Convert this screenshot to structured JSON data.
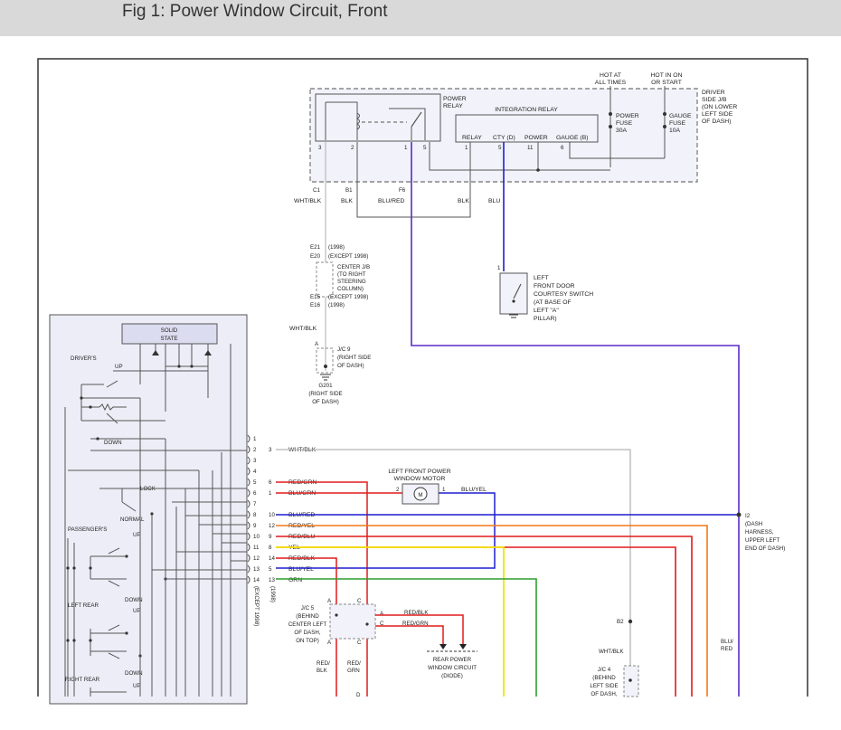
{
  "header": {
    "title": "Fig 1: Power Window Circuit, Front"
  },
  "colors": {
    "header_bg": "#d9d9d9",
    "blue": "#1f1fd1",
    "purple": "#5a2bc8",
    "red": "#e01b1b",
    "orange": "#f07818",
    "yellow": "#f2e600",
    "green": "#2e9e2e",
    "gray": "#b5b5b5",
    "dark": "#555555",
    "panel_bg": "#ededf7"
  },
  "junction_block": {
    "top_labels": [
      {
        "text": "HOT AT",
        "line2": "ALL TIMES"
      },
      {
        "text": "HOT IN ON",
        "line2": "OR START"
      }
    ],
    "name_lines": [
      "DRIVER",
      "SIDE J/B",
      "(ON LOWER",
      "LEFT SIDE",
      "OF DASH)"
    ],
    "power_relay": [
      "POWER",
      "RELAY"
    ],
    "integration_relay": "INTEGRATION RELAY",
    "relay_pins": [
      "RELAY",
      "CTY (D)",
      "POWER",
      "GAUGE (B)"
    ],
    "relay_pin_numbers": [
      "1",
      "5",
      "11",
      "6"
    ],
    "power_fuse": [
      "POWER",
      "FUSE",
      "30A"
    ],
    "gauge_fuse": [
      "GAUGE",
      "FUSE",
      "10A"
    ],
    "relay_coil_pins": [
      "3",
      "2",
      "1",
      "5"
    ],
    "connectors": [
      "C1",
      "B1",
      "F6"
    ]
  },
  "wires_top": [
    "WHT/BLK",
    "BLK",
    "BLU/RED",
    "BLK",
    "BLU"
  ],
  "center_jb": {
    "labels": [
      "E21",
      "(1998)",
      "E20",
      "(EXCEPT 1998)",
      "E15",
      "(EXCEPT 1998)",
      "E16",
      "(1998)"
    ],
    "name": [
      "CENTER J/B",
      "(TO RIGHT",
      "STEERING",
      "COLUMN)"
    ]
  },
  "courtesy_switch": {
    "pin": "1",
    "name": [
      "LEFT",
      "FRONT DOOR",
      "COURTESY SWITCH",
      "(AT BASE OF",
      "LEFT \"A\"",
      "PILLAR)"
    ]
  },
  "jc9": {
    "wire": "WHT/BLK",
    "pin": "A",
    "name": [
      "J/C 9",
      "(RIGHT SIDE",
      "OF DASH)"
    ],
    "ground": [
      "G201",
      "(RIGHT SIDE",
      "OF DASH)"
    ]
  },
  "master_switch": {
    "solid_state": [
      "SOLID",
      "STATE"
    ],
    "labels": [
      "DRIVER'S",
      "UP",
      "DOWN",
      "LOCK",
      "NORMAL",
      "PASSENGER'S",
      "UP",
      "DOWN",
      "LEFT REAR",
      "UP",
      "DOWN",
      "RIGHT REAR",
      "UP"
    ]
  },
  "connector_pins": [
    {
      "pin": "1",
      "cavity": "",
      "wire": ""
    },
    {
      "pin": "2",
      "cavity": "3",
      "wire": "WHT/BLK"
    },
    {
      "pin": "3",
      "cavity": "",
      "wire": ""
    },
    {
      "pin": "4",
      "cavity": "",
      "wire": ""
    },
    {
      "pin": "5",
      "cavity": "6",
      "wire": "RED/GRN"
    },
    {
      "pin": "6",
      "cavity": "1",
      "wire": "BLU/GRN"
    },
    {
      "pin": "7",
      "cavity": "",
      "wire": ""
    },
    {
      "pin": "8",
      "cavity": "10",
      "wire": "BLU/RED"
    },
    {
      "pin": "9",
      "cavity": "12",
      "wire": "RED/YEL"
    },
    {
      "pin": "10",
      "cavity": "9",
      "wire": "RED/BLU"
    },
    {
      "pin": "11",
      "cavity": "8",
      "wire": "YEL"
    },
    {
      "pin": "12",
      "cavity": "14",
      "wire": "RED/BLK"
    },
    {
      "pin": "13",
      "cavity": "5",
      "wire": "BLU/YEL"
    },
    {
      "pin": "14",
      "cavity": "13",
      "wire": "GRN"
    }
  ],
  "except_1998": "(EXCEPT 1998)",
  "label_1998": "(1998)",
  "motor": {
    "name": [
      "LEFT FRONT POWER",
      "WINDOW MOTOR"
    ],
    "symbol": "M",
    "pin_left": "2",
    "pin_right": "1",
    "wire": "BLU/YEL"
  },
  "i2": {
    "name": [
      "I2",
      "(DASH",
      "HARNESS,",
      "UPPER LEFT",
      "END OF DASH)"
    ]
  },
  "jc5": {
    "name": [
      "J/C 5",
      "(BEHIND",
      "CENTER LEFT",
      "OF DASH,",
      "ON TOP)"
    ],
    "pins": [
      "A",
      "C",
      "A",
      "C",
      "A",
      "C"
    ],
    "wires_out": [
      "RED/BLK",
      "RED/GRN"
    ],
    "wires_bottom": [
      [
        "RED/",
        "BLK"
      ],
      [
        "RED/",
        "GRN"
      ]
    ],
    "pin_d": "D"
  },
  "rear_circuit": [
    "REAR POWER",
    "WINDOW CIRCUIT",
    "(DIODE)"
  ],
  "jc4": {
    "pin": "B2",
    "wire": "WHT/BLK",
    "name": [
      "J/C 4",
      "(BEHIND",
      "LEFT SIDE",
      "OF DASH,"
    ]
  },
  "blu_red_right": [
    "BLU/",
    "RED"
  ]
}
